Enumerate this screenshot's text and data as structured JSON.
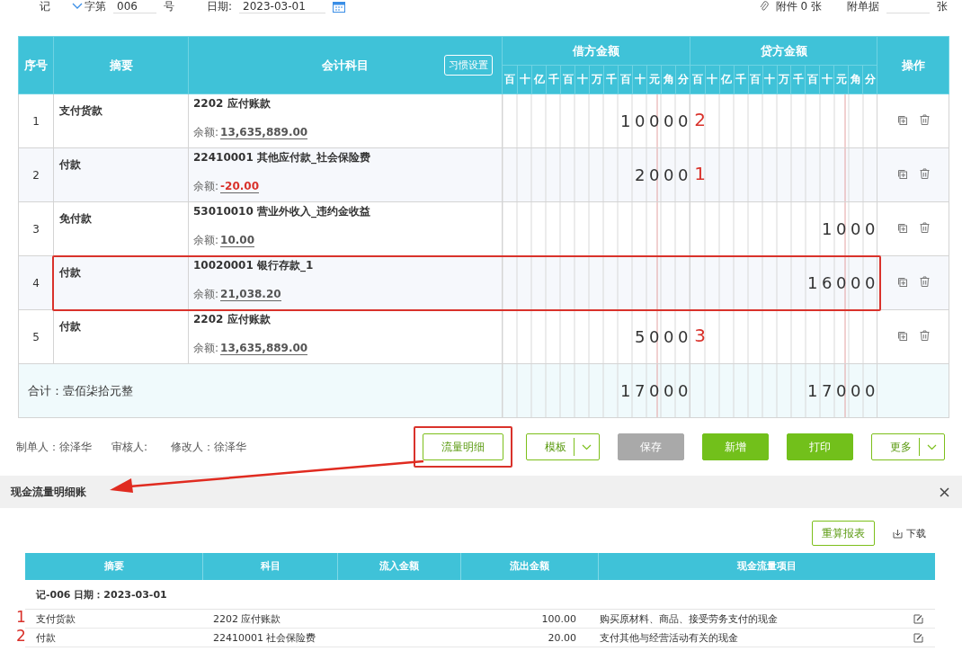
{
  "voucher_bar": {
    "word": "记",
    "word_suffix": "字第",
    "number": "006",
    "number_suffix": "号",
    "date_label": "日期:",
    "date": "2023-03-01",
    "attachments": "附件 0 张",
    "doc_label": "附单据",
    "doc_suffix": "张"
  },
  "voucher_table": {
    "columns": {
      "seq": "序号",
      "summary": "摘要",
      "account": "会计科目",
      "settings_button": "习惯设置",
      "debit": "借方金额",
      "credit": "贷方金额",
      "actions": "操作"
    },
    "debit_units": [
      "百",
      "十",
      "亿",
      "千",
      "百",
      "十",
      "万",
      "千",
      "百",
      "十",
      "元",
      "角",
      "分"
    ],
    "credit_units": [
      "百",
      "十",
      "亿",
      "千",
      "百",
      "十",
      "万",
      "千",
      "百",
      "十",
      "元",
      "角",
      "分"
    ],
    "rows": [
      {
        "seq": "1",
        "summary": "支付货款",
        "account": "2202 应付账款",
        "balance_label": "余额:",
        "balance": "13,635,889.00",
        "negative": false,
        "debit": "10000",
        "debit_note": "2",
        "annotated": false
      },
      {
        "seq": "2",
        "summary": "付款",
        "account": "22410001 其他应付款_社会保险费",
        "balance_label": "余额:",
        "balance": "-20.00",
        "negative": true,
        "debit": "2000",
        "debit_note": "1",
        "annotated": false
      },
      {
        "seq": "3",
        "summary": "免付款",
        "account": "53010010 营业外收入_违约金收益",
        "balance_label": "余额:",
        "balance": "10.00",
        "negative": false,
        "credit": "1000",
        "annotated": false
      },
      {
        "seq": "4",
        "summary": "付款",
        "account": "10020001 银行存款_1",
        "balance_label": "余额:",
        "balance": "21,038.20",
        "negative": false,
        "credit": "16000",
        "annotated": true
      },
      {
        "seq": "5",
        "summary": "付款",
        "account": "2202 应付账款",
        "balance_label": "余额:",
        "balance": "13,635,889.00",
        "negative": false,
        "debit": "5000",
        "debit_note": "3",
        "annotated": false
      }
    ],
    "total": {
      "label": "合计：壹佰柒拾元整",
      "debit": "17000",
      "credit": "17000"
    }
  },
  "footer": {
    "maker": "制单人：徐泽华",
    "reviewer": "审核人:",
    "modifier": "修改人：徐泽华",
    "buttons": [
      {
        "label": "流量明细",
        "kind": "outline",
        "annotated": true
      },
      {
        "label": "模板",
        "kind": "split",
        "annotated": false
      },
      {
        "label": "保存",
        "kind": "disabled",
        "annotated": false
      },
      {
        "label": "新增",
        "kind": "primary",
        "annotated": false
      },
      {
        "label": "打印",
        "kind": "primary",
        "annotated": false
      },
      {
        "label": "更多",
        "kind": "split",
        "annotated": false
      }
    ]
  },
  "cash_flow_panel": {
    "title": "现金流量明细账",
    "recalc_button": "重算报表",
    "download": "下载",
    "columns": [
      "摘要",
      "科目",
      "流入金额",
      "流出金额",
      "现金流量项目"
    ],
    "group": "记-006 日期：2023-03-01",
    "rows": [
      {
        "note": "1",
        "summary": "支付货款",
        "account": "2202 应付账款",
        "outflow": "100.00",
        "item": "购买原材料、商品、接受劳务支付的现金"
      },
      {
        "note": "2",
        "summary": "付款",
        "account": "22410001 社会保险费",
        "outflow": "20.00",
        "item": "支付其他与经营活动有关的现金"
      }
    ]
  }
}
